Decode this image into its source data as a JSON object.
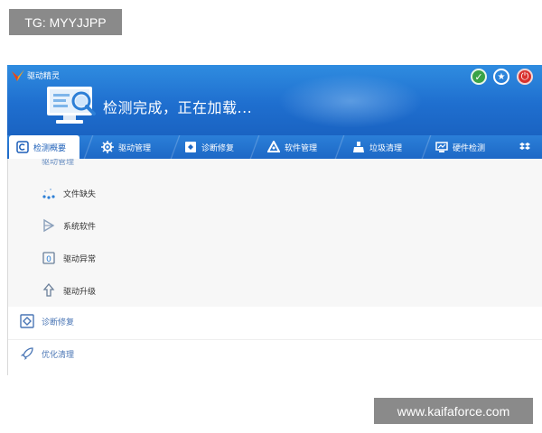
{
  "watermarks": {
    "top": "TG: MYYJJPP",
    "bottom": "www.kaifaforce.com"
  },
  "window": {
    "title": "驱动精灵",
    "status": "检测完成，正在加载..."
  },
  "header_icons": [
    "skin-icon",
    "award-icon",
    "power-icon"
  ],
  "tabs": [
    {
      "label": "检测概要",
      "icon": "overview-icon",
      "active": true
    },
    {
      "label": "驱动管理",
      "icon": "gear-icon",
      "active": false
    },
    {
      "label": "诊断修复",
      "icon": "repair-icon",
      "active": false
    },
    {
      "label": "软件管理",
      "icon": "software-icon",
      "active": false
    },
    {
      "label": "垃圾清理",
      "icon": "broom-icon",
      "active": false
    },
    {
      "label": "硬件检测",
      "icon": "hardware-icon",
      "active": false
    }
  ],
  "content": {
    "partial_row": "驱动管理",
    "sub_items": [
      {
        "label": "文件缺失",
        "icon": "missing-file-icon"
      },
      {
        "label": "系统软件",
        "icon": "system-software-icon"
      },
      {
        "label": "驱动异常",
        "icon": "driver-error-icon"
      },
      {
        "label": "驱动升级",
        "icon": "upgrade-icon"
      }
    ],
    "sections": [
      {
        "label": "诊断修复",
        "icon": "repair-icon"
      },
      {
        "label": "优化清理",
        "icon": "rocket-icon"
      }
    ]
  },
  "colors": {
    "header_blue": "#1f6fcf",
    "tab_active_text": "#1d5fb8",
    "section_text": "#4a76b5"
  }
}
